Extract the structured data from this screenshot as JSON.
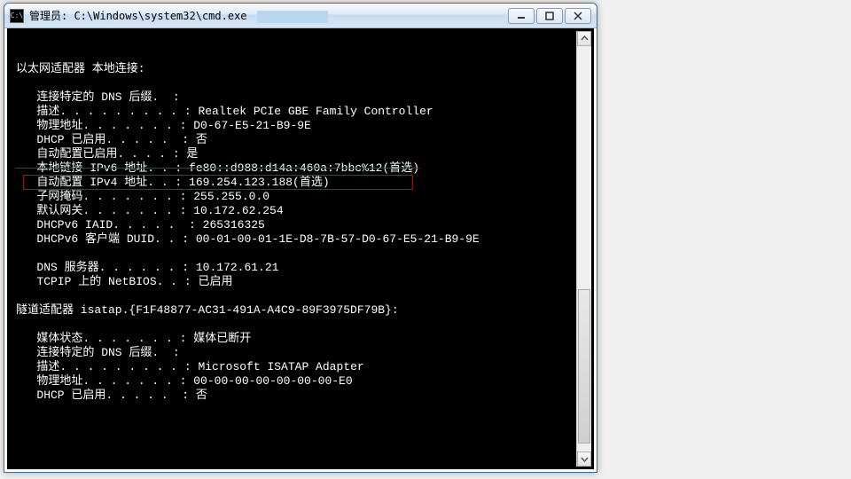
{
  "titlebar": {
    "icon_label": "C:\\",
    "text": "管理员: C:\\Windows\\system32\\cmd.exe"
  },
  "window_buttons": {
    "min": "minimize",
    "max": "maximize",
    "close": "close"
  },
  "ethernet": {
    "header": "以太网适配器 本地连接:",
    "rows": [
      {
        "label": "连接特定的 DNS 后缀",
        "value": ""
      },
      {
        "label": "描述",
        "value": "Realtek PCIe GBE Family Controller"
      },
      {
        "label": "物理地址",
        "value": "D0-67-E5-21-B9-9E"
      },
      {
        "label": "DHCP 已启用",
        "value": "否"
      },
      {
        "label": "自动配置已启用",
        "value": "是"
      },
      {
        "label": "本地链接 IPv6 地址",
        "value": "fe80::d988:d14a:460a:7bbc%12(首选)",
        "strike": true
      },
      {
        "label": "自动配置 IPv4 地址",
        "value": "169.254.123.188(首选)",
        "highlight": true
      },
      {
        "label": "子网掩码",
        "value": "255.255.0.0"
      },
      {
        "label": "默认网关",
        "value": "10.172.62.254"
      },
      {
        "label": "DHCPv6 IAID",
        "value": "265316325"
      },
      {
        "label": "DHCPv6 客户端 DUID",
        "value": "00-01-00-01-1E-D8-7B-57-D0-67-E5-21-B9-9E"
      },
      {
        "label": "",
        "value": ""
      },
      {
        "label": "DNS 服务器",
        "value": "10.172.61.21"
      },
      {
        "label": "TCPIP 上的 NetBIOS",
        "value": "已启用"
      }
    ]
  },
  "tunnel": {
    "header": "隧道适配器 isatap.{F1F48877-AC31-491A-A4C9-89F3975DF79B}:",
    "rows": [
      {
        "label": "媒体状态",
        "value": "媒体已断开"
      },
      {
        "label": "连接特定的 DNS 后缀",
        "value": ""
      },
      {
        "label": "描述",
        "value": "Microsoft ISATAP Adapter"
      },
      {
        "label": "物理地址",
        "value": "00-00-00-00-00-00-00-E0"
      },
      {
        "label": "DHCP 已启用",
        "value": "否"
      }
    ]
  },
  "layout": {
    "indent": "   ",
    "label_width_cols": 24,
    "sep": ": "
  }
}
